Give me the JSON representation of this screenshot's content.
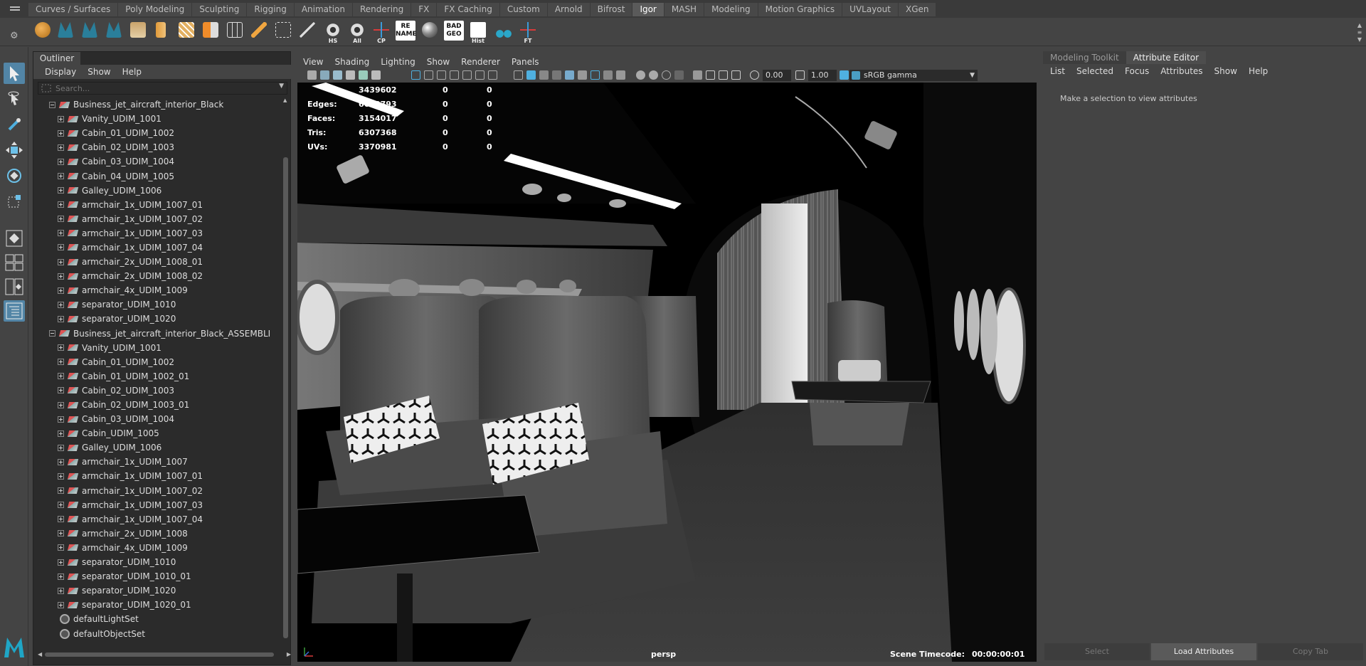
{
  "shelf": {
    "tabs": [
      "Curves / Surfaces",
      "Poly Modeling",
      "Sculpting",
      "Rigging",
      "Animation",
      "Rendering",
      "FX",
      "FX Caching",
      "Custom",
      "Arnold",
      "Bifrost",
      "Igor",
      "MASH",
      "Modeling",
      "Motion Graphics",
      "UVLayout",
      "XGen"
    ],
    "active_tab": "Igor",
    "labeled_icons": {
      "hs": "HS",
      "all": "All",
      "cp": "CP",
      "rename_l1": "RE",
      "rename_l2": "NAME",
      "badgeo_l1": "BAD",
      "badgeo_l2": "GEO",
      "hist": "Hist",
      "ft": "FT"
    }
  },
  "outliner": {
    "tab": "Outliner",
    "menu": [
      "Display",
      "Show",
      "Help"
    ],
    "search_placeholder": "Search...",
    "groups": [
      {
        "name": "Business_jet_aircraft_interior_Black",
        "children": [
          "Vanity_UDIM_1001",
          "Cabin_01_UDIM_1002",
          "Cabin_02_UDIM_1003",
          "Cabin_03_UDIM_1004",
          "Cabin_04_UDIM_1005",
          "Galley_UDIM_1006",
          "armchair_1x_UDIM_1007_01",
          "armchair_1x_UDIM_1007_02",
          "armchair_1x_UDIM_1007_03",
          "armchair_1x_UDIM_1007_04",
          "armchair_2x_UDIM_1008_01",
          "armchair_2x_UDIM_1008_02",
          "armchair_4x_UDIM_1009",
          "separator_UDIM_1010",
          "separator_UDIM_1020"
        ]
      },
      {
        "name": "Business_jet_aircraft_interior_Black_ASSEMBLI",
        "children": [
          "Vanity_UDIM_1001",
          "Cabin_01_UDIM_1002",
          "Cabin_01_UDIM_1002_01",
          "Cabin_02_UDIM_1003",
          "Cabin_02_UDIM_1003_01",
          "Cabin_03_UDIM_1004",
          "Cabin_UDIM_1005",
          "Galley_UDIM_1006",
          "armchair_1x_UDIM_1007",
          "armchair_1x_UDIM_1007_01",
          "armchair_1x_UDIM_1007_02",
          "armchair_1x_UDIM_1007_03",
          "armchair_1x_UDIM_1007_04",
          "armchair_2x_UDIM_1008",
          "armchair_4x_UDIM_1009",
          "separator_UDIM_1010",
          "separator_UDIM_1010_01",
          "separator_UDIM_1020",
          "separator_UDIM_1020_01"
        ]
      }
    ],
    "sets": [
      "defaultLightSet",
      "defaultObjectSet"
    ]
  },
  "viewport": {
    "menu": [
      "View",
      "Shading",
      "Lighting",
      "Show",
      "Renderer",
      "Panels"
    ],
    "exposure": "0.00",
    "gamma": "1.00",
    "color_space": "sRGB gamma",
    "hud": [
      {
        "key": "",
        "v1": "3439602",
        "v2": "0",
        "v3": "0"
      },
      {
        "key": "Edges:",
        "v1": "6640793",
        "v2": "0",
        "v3": "0"
      },
      {
        "key": "Faces:",
        "v1": "3154017",
        "v2": "0",
        "v3": "0"
      },
      {
        "key": "Tris:",
        "v1": "6307368",
        "v2": "0",
        "v3": "0"
      },
      {
        "key": "UVs:",
        "v1": "3370981",
        "v2": "0",
        "v3": "0"
      }
    ],
    "camera": "persp",
    "timecode_label": "Scene Timecode:",
    "timecode": "00:00:00:01"
  },
  "attribute_editor": {
    "tabs": [
      "Modeling Toolkit",
      "Attribute Editor"
    ],
    "active_tab": "Attribute Editor",
    "menu": [
      "List",
      "Selected",
      "Focus",
      "Attributes",
      "Show",
      "Help"
    ],
    "message": "Make a selection to view attributes",
    "buttons": [
      "Select",
      "Load Attributes",
      "Copy Tab"
    ]
  },
  "colors": {
    "accent": "#5285a6",
    "panel": "#444444",
    "dark": "#2b2b2b"
  }
}
